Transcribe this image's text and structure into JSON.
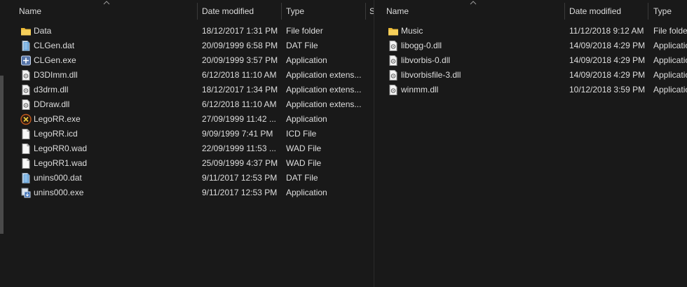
{
  "left_pane": {
    "columns": {
      "name": "Name",
      "date": "Date modified",
      "type": "Type",
      "size": "S"
    },
    "files": [
      {
        "name": "Data",
        "date": "18/12/2017 1:31 PM",
        "type": "File folder",
        "icon": "folder-icon"
      },
      {
        "name": "CLGen.dat",
        "date": "20/09/1999 6:58 PM",
        "type": "DAT File",
        "icon": "dat-file-icon"
      },
      {
        "name": "CLGen.exe",
        "date": "20/09/1999 3:57 PM",
        "type": "Application",
        "icon": "app-icon"
      },
      {
        "name": "D3DImm.dll",
        "date": "6/12/2018 11:10 AM",
        "type": "Application extens...",
        "icon": "dll-file-icon"
      },
      {
        "name": "d3drm.dll",
        "date": "18/12/2017 1:34 PM",
        "type": "Application extens...",
        "icon": "dll-file-icon"
      },
      {
        "name": "DDraw.dll",
        "date": "6/12/2018 11:10 AM",
        "type": "Application extens...",
        "icon": "dll-file-icon"
      },
      {
        "name": "LegoRR.exe",
        "date": "27/09/1999 11:42 ...",
        "type": "Application",
        "icon": "legorr-app-icon"
      },
      {
        "name": "LegoRR.icd",
        "date": "9/09/1999 7:41 PM",
        "type": "ICD File",
        "icon": "blank-file-icon"
      },
      {
        "name": "LegoRR0.wad",
        "date": "22/09/1999 11:53 ...",
        "type": "WAD File",
        "icon": "blank-file-icon"
      },
      {
        "name": "LegoRR1.wad",
        "date": "25/09/1999 4:37 PM",
        "type": "WAD File",
        "icon": "blank-file-icon"
      },
      {
        "name": "unins000.dat",
        "date": "9/11/2017 12:53 PM",
        "type": "DAT File",
        "icon": "dat-file-icon"
      },
      {
        "name": "unins000.exe",
        "date": "9/11/2017 12:53 PM",
        "type": "Application",
        "icon": "installer-icon"
      }
    ]
  },
  "right_pane": {
    "columns": {
      "name": "Name",
      "date": "Date modified",
      "type": "Type"
    },
    "files": [
      {
        "name": "Music",
        "date": "11/12/2018 9:12 AM",
        "type": "File folder",
        "icon": "folder-icon"
      },
      {
        "name": "libogg-0.dll",
        "date": "14/09/2018 4:29 PM",
        "type": "Application extens...",
        "icon": "dll-file-icon"
      },
      {
        "name": "libvorbis-0.dll",
        "date": "14/09/2018 4:29 PM",
        "type": "Application extens...",
        "icon": "dll-file-icon"
      },
      {
        "name": "libvorbisfile-3.dll",
        "date": "14/09/2018 4:29 PM",
        "type": "Application extens...",
        "icon": "dll-file-icon"
      },
      {
        "name": "winmm.dll",
        "date": "10/12/2018 3:59 PM",
        "type": "Application extens...",
        "icon": "dll-file-icon"
      }
    ]
  },
  "colors": {
    "background": "#191919",
    "text": "#dedede",
    "header_separator": "#3a3a3a",
    "folder": "#f3c84a"
  }
}
